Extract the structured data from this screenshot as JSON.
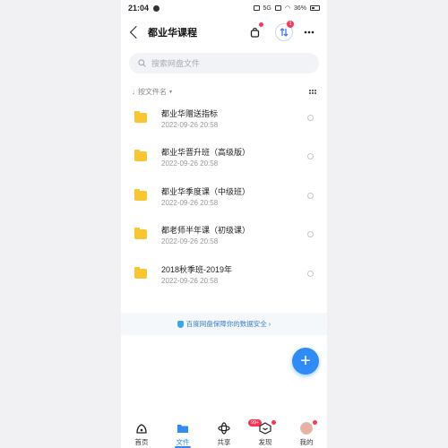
{
  "status": {
    "time": "21:04",
    "network": "5G",
    "battery": "36%"
  },
  "header": {
    "title": "都业华课程",
    "badge_count": "1"
  },
  "search": {
    "placeholder": "搜索网盘文件"
  },
  "sort": {
    "label": "按文件名"
  },
  "files": [
    {
      "name": "都业华赠送指标",
      "date": "2022-09-26  20:58"
    },
    {
      "name": "都业华晋升班（高级版）",
      "date": "2022-09-26  20:58"
    },
    {
      "name": "都业华季度课（中级班）",
      "date": "2022-09-26  20:58"
    },
    {
      "name": "都老师半年课（初级课）",
      "date": "2022-09-26  20:58"
    },
    {
      "name": "2018秋季班-2019年",
      "date": "2022-09-26  20:58"
    }
  ],
  "safety_banner": {
    "text": "百度网盘保障你的数据安全 ›"
  },
  "fab": {
    "icon": "plus-icon",
    "label": "+"
  },
  "tabs": [
    {
      "label": "首页",
      "icon": "home-icon"
    },
    {
      "label": "文件",
      "icon": "folder-icon"
    },
    {
      "label": "共享",
      "icon": "share-icon",
      "badge": "99+"
    },
    {
      "label": "发现",
      "icon": "discover-icon"
    },
    {
      "label": "我的",
      "icon": "avatar-icon"
    }
  ],
  "colors": {
    "accent": "#2f8cf6",
    "folder": "#f9c531",
    "badge": "#ff3355"
  }
}
